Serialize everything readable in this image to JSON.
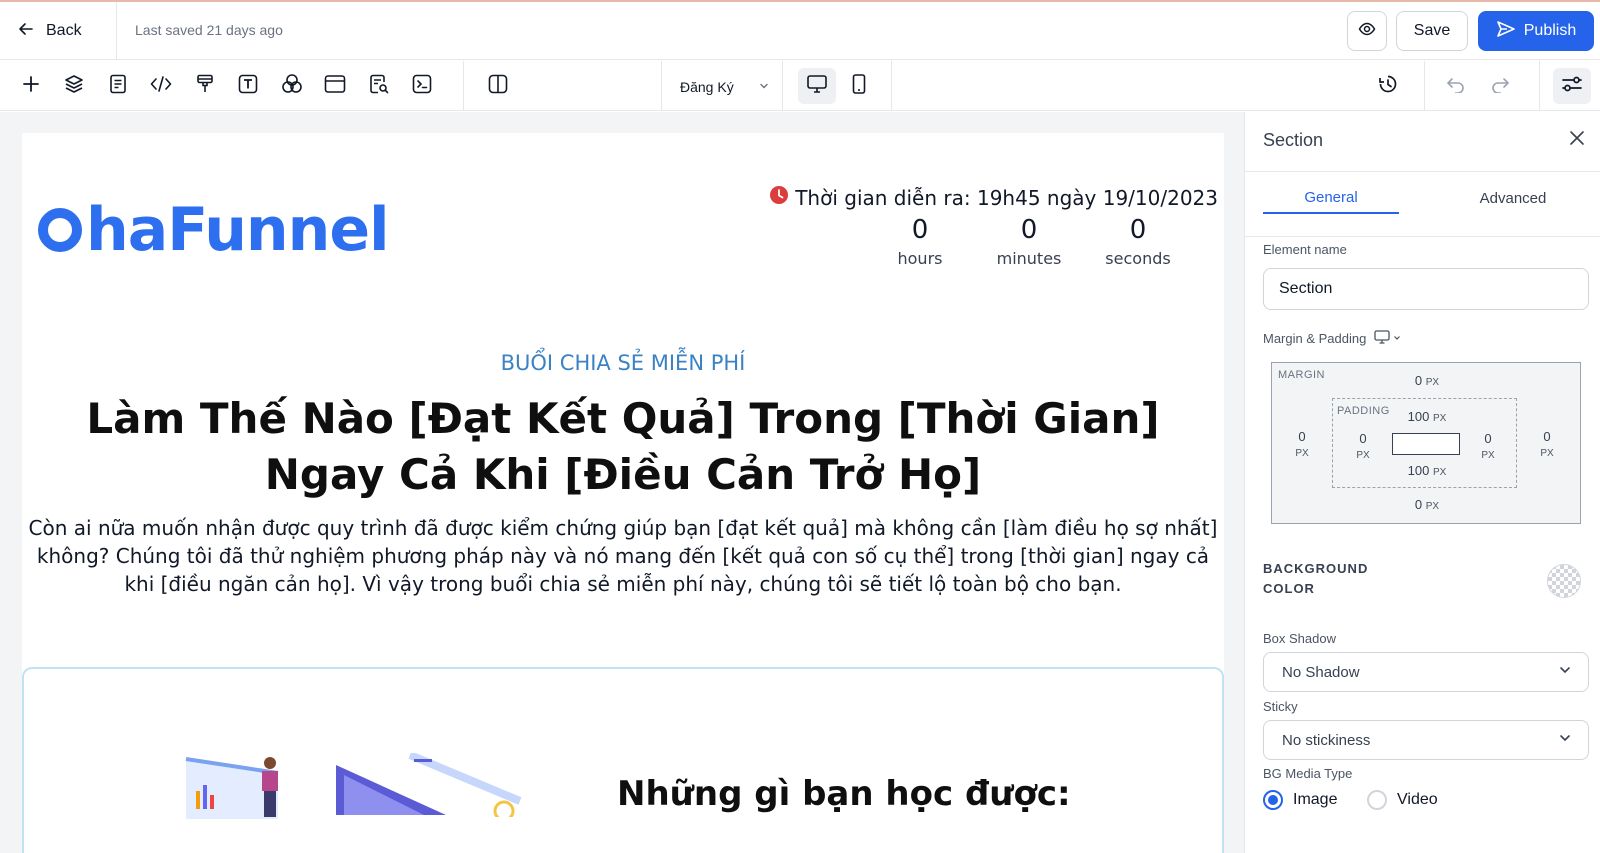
{
  "topbar": {
    "back_label": "Back",
    "last_saved": "Last saved 21 days ago",
    "save_label": "Save",
    "publish_label": "Publish"
  },
  "toolbar": {
    "tools": [
      "plus-icon",
      "layers-icon",
      "document-icon",
      "code-icon",
      "paint-brush-icon",
      "text-icon",
      "shapes-icon",
      "window-icon",
      "search-doc-icon",
      "terminal-icon",
      "split-view-icon"
    ],
    "page_select": "Đăng Ký",
    "device_active": "desktop"
  },
  "canvas": {
    "logo_text": "haFunnel",
    "countdown_title": "Thời gian diễn ra: 19h45 ngày 19/10/2023",
    "countdown": [
      {
        "value": "0",
        "label": "hours"
      },
      {
        "value": "0",
        "label": "minutes"
      },
      {
        "value": "0",
        "label": "seconds"
      }
    ],
    "eyebrow": "BUỔI CHIA SẺ MIỄN PHÍ",
    "headline": "Làm Thế Nào [Đạt Kết Quả] Trong [Thời Gian] Ngay Cả Khi [Điều Cản Trở Họ]",
    "body": "Còn ai nữa muốn nhận được quy trình đã được kiểm chứng giúp bạn [đạt kết quả] mà không cần [làm điều họ sợ nhất] không? Chúng tôi đã thử nghiệm phương pháp này và nó mang đến [kết quả con số cụ thể] trong [thời gian] ngay cả khi [điều ngăn cản họ]. Vì vậy trong buổi chia sẻ miễn phí này, chúng tôi sẽ tiết lộ toàn bộ cho bạn.",
    "learn_title": "Những gì bạn học được:",
    "brand_color": "#2e6ff0",
    "eyebrow_color": "#3b82c4"
  },
  "panel": {
    "title": "Section",
    "tabs": {
      "general": "General",
      "advanced": "Advanced"
    },
    "element_name_label": "Element name",
    "element_name_value": "Section",
    "margin_padding_label": "Margin & Padding",
    "margin_label": "MARGIN",
    "padding_label": "PADDING",
    "margin": {
      "top": "0",
      "right": "0",
      "bottom": "0",
      "left": "0"
    },
    "padding": {
      "top": "100",
      "right": "0",
      "bottom": "100",
      "left": "0"
    },
    "unit": "PX",
    "background_color_label": "BACKGROUND COLOR",
    "box_shadow_label": "Box Shadow",
    "box_shadow_value": "No Shadow",
    "sticky_label": "Sticky",
    "sticky_value": "No stickiness",
    "bg_media_type_label": "BG Media Type",
    "media_options": {
      "image": "Image",
      "video": "Video"
    },
    "media_selected": "image"
  },
  "colors": {
    "primary": "#2563eb",
    "section_border": "#bfe3f3",
    "clock_red": "#dc3c3c"
  }
}
